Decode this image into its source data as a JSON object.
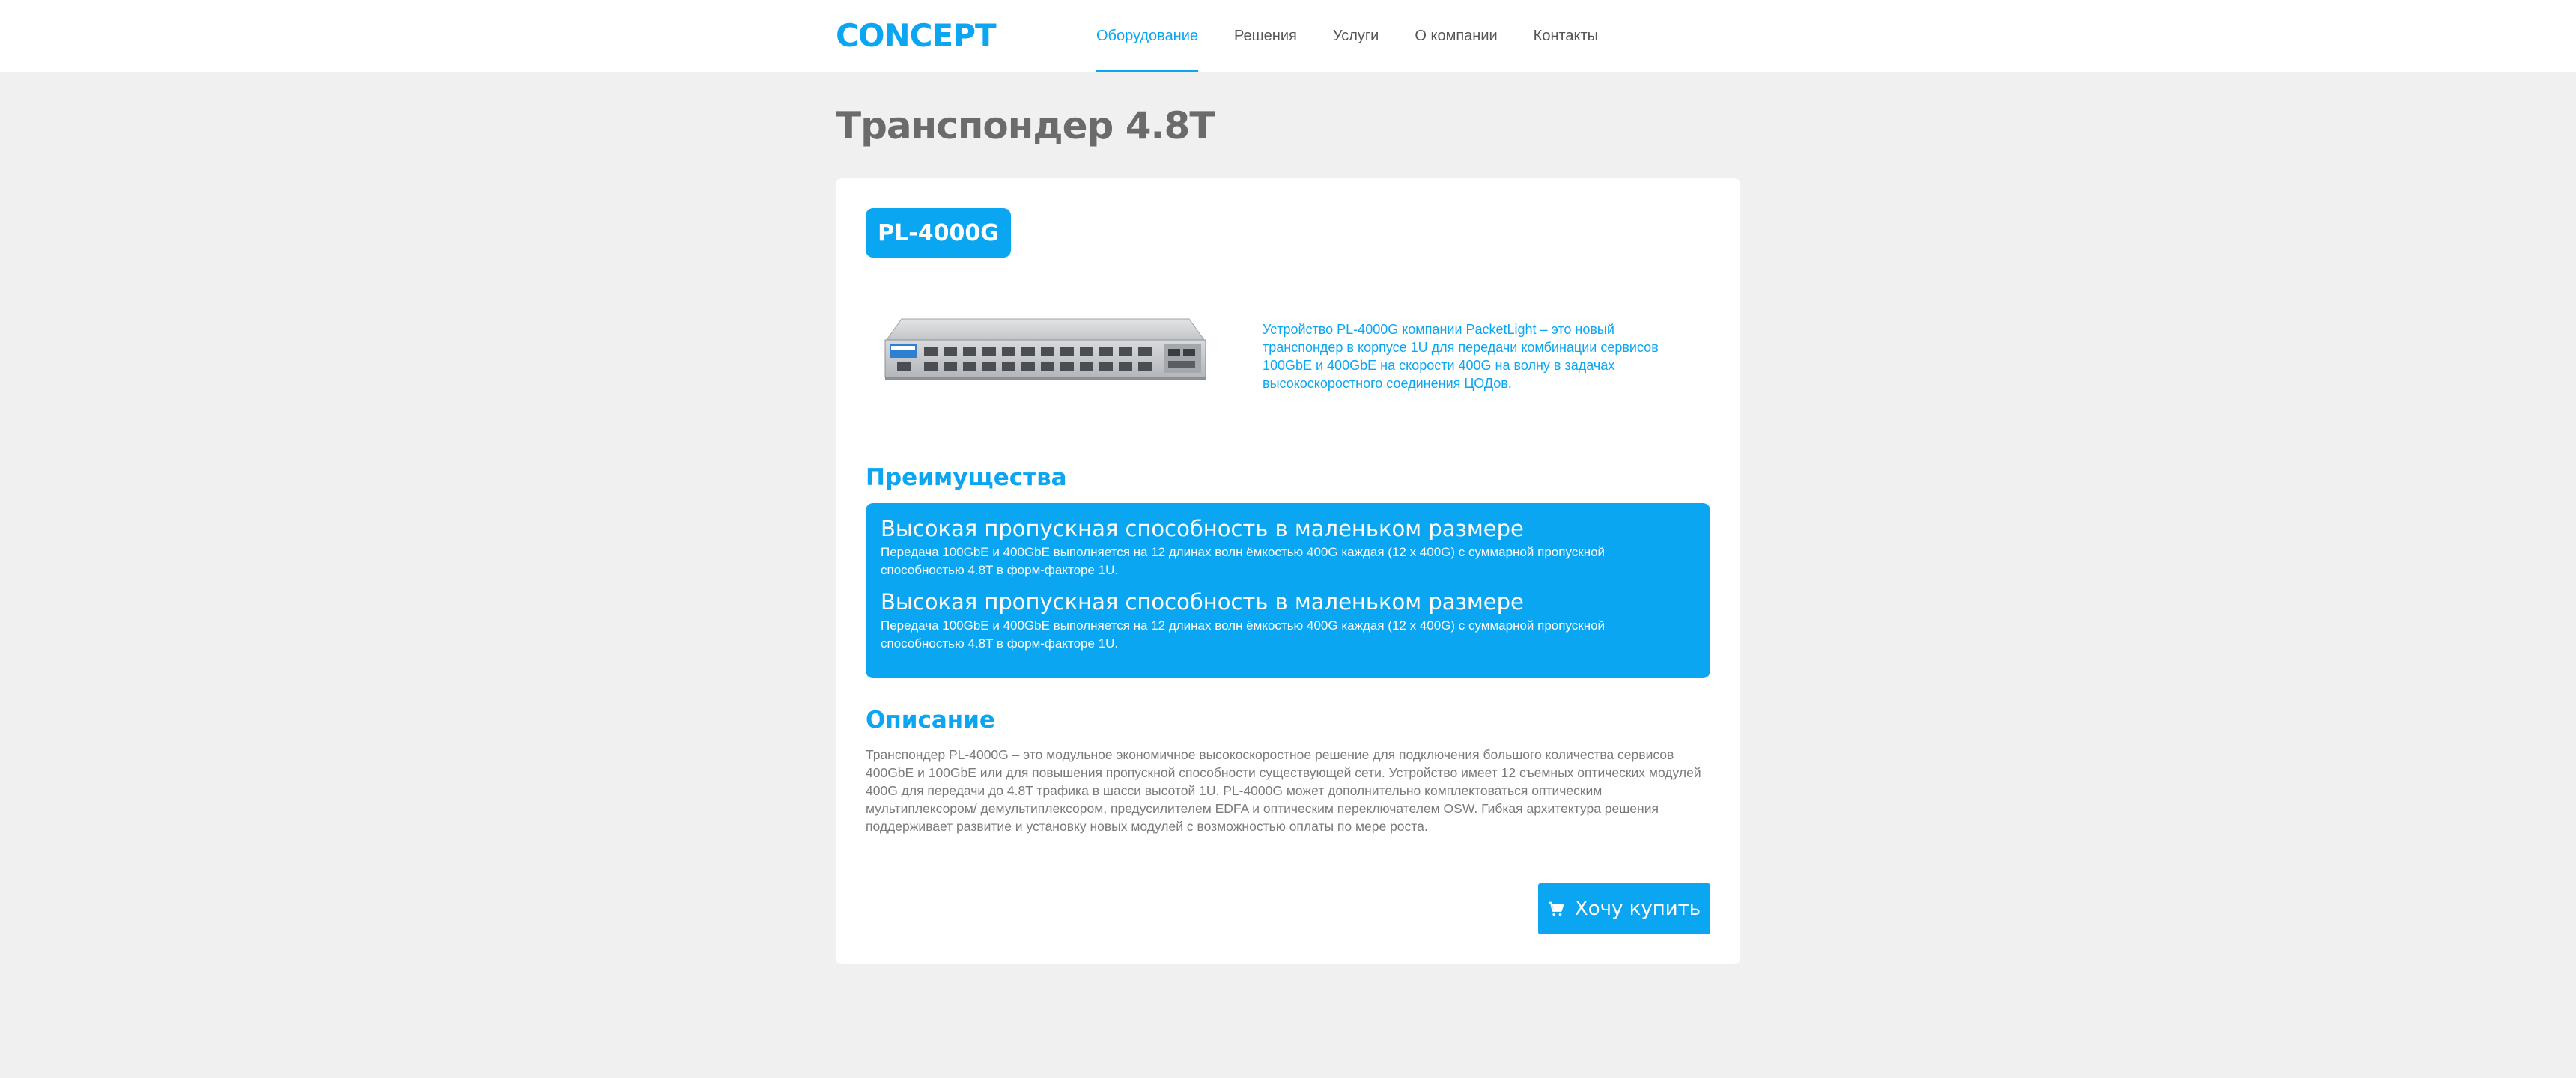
{
  "header": {
    "logo": "CONCEPT",
    "nav": [
      {
        "label": "Оборудование",
        "active": true
      },
      {
        "label": "Решения",
        "active": false
      },
      {
        "label": "Услуги",
        "active": false
      },
      {
        "label": "О компании",
        "active": false
      },
      {
        "label": "Контакты",
        "active": false
      }
    ]
  },
  "page": {
    "title": "Транспондер 4.8T"
  },
  "product": {
    "model": "PL-4000G",
    "intro": "Устройство PL-4000G компании PacketLight – это новый транспондер в корпусе 1U для передачи комбинации сервисов 100GbE и 400GbE на скорости 400G на волну в задачах высокоскоростного соединения ЦОДов.",
    "advantages_heading": "Преимущества",
    "advantages": [
      {
        "title": "Высокая пропускная способность в маленьком размере",
        "text": "Передача 100GbE и 400GbE выполняется на 12 длинах волн ёмкостью 400G каждая (12 x 400G) с суммарной пропускной способностью 4.8T в форм-факторе 1U."
      },
      {
        "title": "Высокая пропускная способность в маленьком размере",
        "text": "Передача 100GbE и 400GbE выполняется на 12 длинах волн ёмкостью 400G каждая (12 x 400G) с суммарной пропускной способностью 4.8T в форм-факторе 1U."
      }
    ],
    "description_heading": "Описание",
    "description": "Транспондер PL-4000G – это модульное экономичное высокоскоростное решение для подключения большого количества сервисов 400GbE и 100GbE или для повышения пропускной способности существующей сети. Устройство имеет 12 съемных оптических модулей 400G для передачи до 4.8T трафика в шасси высотой 1U. PL-4000G может дополнительно комплектоваться оптическим мультиплексором/ демультиплексором, предусилителем EDFA и оптическим переключателем OSW. Гибкая архитектура решения поддерживает развитие и установку новых модулей с возможностью оплаты по мере роста.",
    "buy_label": "Хочу купить",
    "buy_icon": "cart-icon"
  },
  "colors": {
    "accent": "#0aa6f2",
    "background": "#f0f0f0",
    "card": "#ffffff",
    "title": "#6b6b6b"
  }
}
